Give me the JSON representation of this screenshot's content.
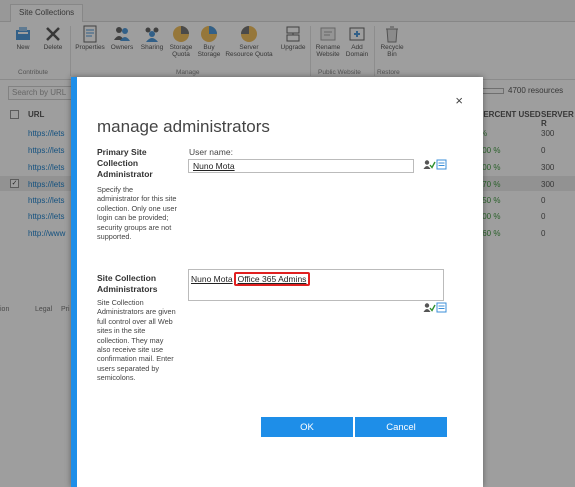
{
  "ribbon": {
    "tab": "Site Collections",
    "buttons": [
      {
        "label": "New",
        "icon": "new-icon"
      },
      {
        "label": "Delete",
        "icon": "delete-icon"
      },
      {
        "label": "Properties",
        "icon": "properties-icon"
      },
      {
        "label": "Owners",
        "icon": "owners-icon"
      },
      {
        "label": "Sharing",
        "icon": "sharing-icon"
      },
      {
        "label": "Storage Quota",
        "icon": "storage-quota-icon"
      },
      {
        "label": "Buy Storage",
        "icon": "buy-storage-icon"
      },
      {
        "label": "Server Resource Quota",
        "icon": "server-resource-quota-icon"
      },
      {
        "label": "Upgrade",
        "icon": "upgrade-icon"
      },
      {
        "label": "Rename Website",
        "icon": "rename-website-icon"
      },
      {
        "label": "Add Domain",
        "icon": "add-domain-icon"
      },
      {
        "label": "Recycle Bin",
        "icon": "recycle-bin-icon"
      }
    ],
    "groups": {
      "contribute": "Contribute",
      "manage": "Manage",
      "public_website": "Public Website",
      "restore": "Restore"
    }
  },
  "list": {
    "search_placeholder": "Search by URL",
    "resources_text": "4700 resources",
    "headers": {
      "url": "URL",
      "percent_used": "PERCENT USED",
      "server": "SERVER R"
    },
    "rows": [
      {
        "url": "https://lets",
        "pct": "%",
        "server": "300"
      },
      {
        "url": "https://lets",
        "pct": ".00 %",
        "server": "0"
      },
      {
        "url": "https://lets",
        "pct": ".00 %",
        "server": "300"
      },
      {
        "url": "https://lets",
        "pct": ".70 %",
        "server": "300"
      },
      {
        "url": "https://lets",
        "pct": ".50 %",
        "server": "0"
      },
      {
        "url": "https://lets",
        "pct": ".00 %",
        "server": "0"
      },
      {
        "url": "http://www",
        "pct": ".60 %",
        "server": "0"
      }
    ],
    "footer_legal": "Legal",
    "footer_privacy": "Pri",
    "footer_left": "ion"
  },
  "dialog": {
    "title": "manage administrators",
    "primary": {
      "title_line1": "Primary Site",
      "title_line2": "Collection",
      "title_line3": "Administrator",
      "desc": "Specify the administrator for this site collection. Only one user login can be provided; security groups are not supported.",
      "field_label": "User name:",
      "value": "Nuno Mota"
    },
    "admins": {
      "title_line1": "Site Collection",
      "title_line2": "Administrators",
      "desc": "Site Collection Administrators are given full control over all Web sites in the site collection. They may also receive site use confirmation mail. Enter users separated by semicolons.",
      "user1": "Nuno Mota",
      "user2": "Office 365 Admins"
    },
    "ok_label": "OK",
    "cancel_label": "Cancel",
    "close_glyph": "×"
  },
  "colors": {
    "accent": "#1e8ee8",
    "highlight": "#e02020"
  }
}
